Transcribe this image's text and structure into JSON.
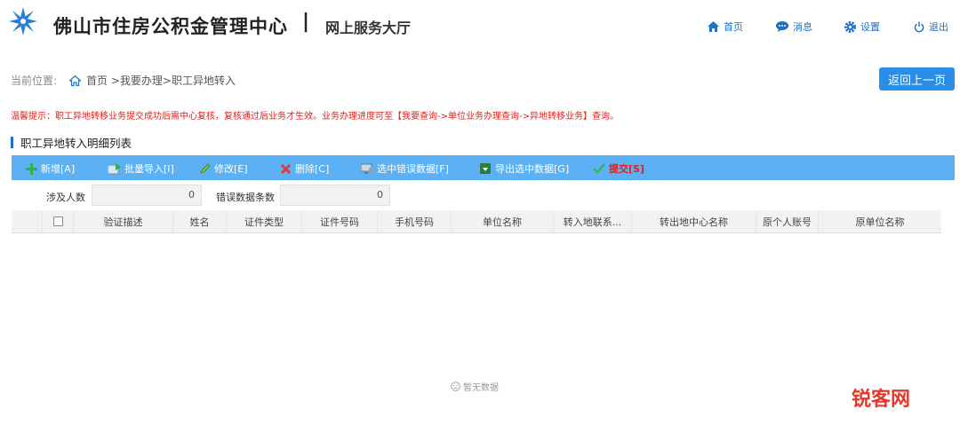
{
  "header": {
    "site_title": "佛山市住房公积金管理中心",
    "separator": "|",
    "subtitle": "网上服务大厅",
    "nav": {
      "home": "首页",
      "messages": "消息",
      "settings": "设置",
      "logout": "退出"
    }
  },
  "breadcrumb": {
    "label": "当前位置:",
    "path": "首页 >我要办理>职工异地转入"
  },
  "back_button": "返回上一页",
  "notice": "温馨提示：职工异地转移业务提交成功后需中心复核，复核通过后业务才生效。业务办理进度可至【我要查询->单位业务办理查询->异地转移业务】查询。",
  "section_title": "职工异地转入明细列表",
  "toolbar": {
    "add": "新增[A]",
    "batch_import": "批量导入[I]",
    "edit": "修改[E]",
    "delete": "删除[C]",
    "select_errors": "选中错误数据[F]",
    "export_selected": "导出选中数据[G]",
    "submit": "提交[S]"
  },
  "summary": {
    "people_label": "涉及人数",
    "people_value": "0",
    "error_label": "错误数据条数",
    "error_value": "0"
  },
  "table": {
    "columns": [
      "验证描述",
      "姓名",
      "证件类型",
      "证件号码",
      "手机号码",
      "单位名称",
      "转入地联系...",
      "转出地中心名称",
      "原个人账号",
      "原单位名称"
    ]
  },
  "empty_text": "暂无数据",
  "watermark": "锐客网",
  "colors": {
    "primary": "#2a8ee8",
    "toolbar": "#5cb1f5",
    "notice": "#e0201b",
    "nav_link": "#1f6fc4"
  }
}
